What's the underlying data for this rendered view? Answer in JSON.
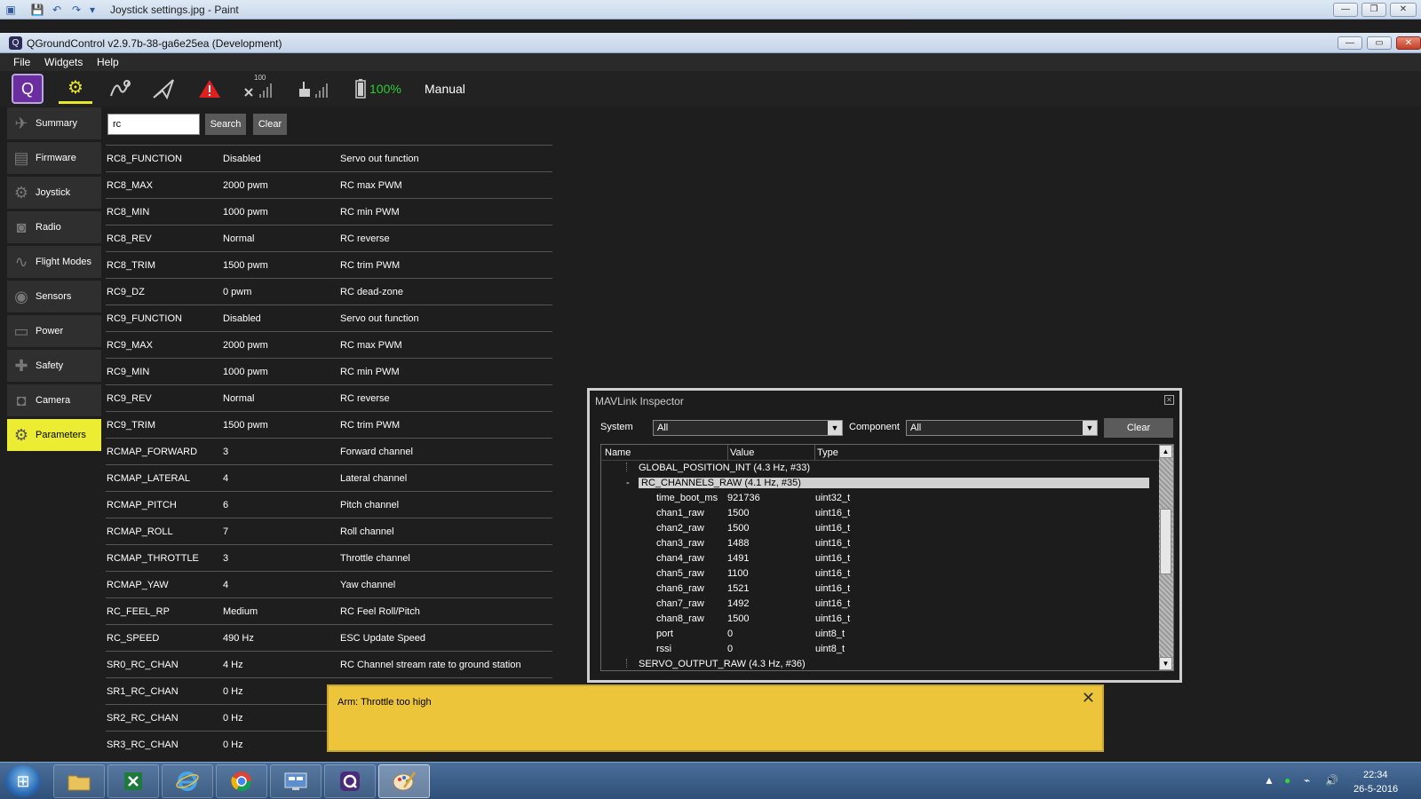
{
  "paint": {
    "title": "Joystick settings.jpg - Paint"
  },
  "window": {
    "title": "QGroundControl v2.9.7b-38-ga6e25ea (Development)"
  },
  "menubar": [
    "File",
    "Widgets",
    "Help"
  ],
  "toolbar": {
    "battery_percent": "100%",
    "flight_mode": "Manual",
    "gps_count_label": "100",
    "icons": [
      "qgc-logo-icon",
      "setup-gears-icon",
      "plan-waypoint-icon",
      "fly-paperplane-icon",
      "warning-icon",
      "gps-satellite-icon",
      "rc-signal-icon",
      "battery-icon"
    ],
    "colors": {
      "active_accent": "#e6e62a",
      "battery_ok": "#2ecc2e",
      "warning": "#e02020"
    }
  },
  "sidebar": {
    "items": [
      {
        "label": "Summary",
        "icon": "paperplane-icon"
      },
      {
        "label": "Firmware",
        "icon": "firmware-icon"
      },
      {
        "label": "Joystick",
        "icon": "joystick-icon"
      },
      {
        "label": "Radio",
        "icon": "radio-icon"
      },
      {
        "label": "Flight Modes",
        "icon": "waves-icon"
      },
      {
        "label": "Sensors",
        "icon": "sensors-icon"
      },
      {
        "label": "Power",
        "icon": "power-icon"
      },
      {
        "label": "Safety",
        "icon": "safety-icon"
      },
      {
        "label": "Camera",
        "icon": "camera-icon"
      },
      {
        "label": "Parameters",
        "icon": "gears-icon"
      }
    ],
    "active_index": 9
  },
  "search": {
    "value": "rc",
    "search_label": "Search",
    "clear_label": "Clear"
  },
  "params": [
    {
      "name": "RC8_FUNCTION",
      "value": "Disabled",
      "desc": "Servo out function"
    },
    {
      "name": "RC8_MAX",
      "value": "2000 pwm",
      "desc": "RC max PWM"
    },
    {
      "name": "RC8_MIN",
      "value": "1000 pwm",
      "desc": "RC min PWM"
    },
    {
      "name": "RC8_REV",
      "value": "Normal",
      "desc": "RC reverse"
    },
    {
      "name": "RC8_TRIM",
      "value": "1500 pwm",
      "desc": "RC trim PWM"
    },
    {
      "name": "RC9_DZ",
      "value": "0 pwm",
      "desc": "RC dead-zone"
    },
    {
      "name": "RC9_FUNCTION",
      "value": "Disabled",
      "desc": "Servo out function"
    },
    {
      "name": "RC9_MAX",
      "value": "2000 pwm",
      "desc": "RC max PWM"
    },
    {
      "name": "RC9_MIN",
      "value": "1000 pwm",
      "desc": "RC min PWM"
    },
    {
      "name": "RC9_REV",
      "value": "Normal",
      "desc": "RC reverse"
    },
    {
      "name": "RC9_TRIM",
      "value": "1500 pwm",
      "desc": "RC trim PWM"
    },
    {
      "name": "RCMAP_FORWARD",
      "value": "3",
      "desc": "Forward channel"
    },
    {
      "name": "RCMAP_LATERAL",
      "value": "4",
      "desc": "Lateral channel"
    },
    {
      "name": "RCMAP_PITCH",
      "value": "6",
      "desc": "Pitch channel"
    },
    {
      "name": "RCMAP_ROLL",
      "value": "7",
      "desc": "Roll channel"
    },
    {
      "name": "RCMAP_THROTTLE",
      "value": "3",
      "desc": "Throttle channel"
    },
    {
      "name": "RCMAP_YAW",
      "value": "4",
      "desc": "Yaw channel"
    },
    {
      "name": "RC_FEEL_RP",
      "value": "Medium",
      "desc": "RC Feel Roll/Pitch"
    },
    {
      "name": "RC_SPEED",
      "value": "490 Hz",
      "desc": "ESC Update Speed"
    },
    {
      "name": "SR0_RC_CHAN",
      "value": "4 Hz",
      "desc": "RC Channel stream rate to ground station"
    },
    {
      "name": "SR1_RC_CHAN",
      "value": "0 Hz",
      "desc": ""
    },
    {
      "name": "SR2_RC_CHAN",
      "value": "0 Hz",
      "desc": ""
    },
    {
      "name": "SR3_RC_CHAN",
      "value": "0 Hz",
      "desc": ""
    }
  ],
  "mavlink": {
    "title": "MAVLink Inspector",
    "system_label": "System",
    "system_value": "All",
    "component_label": "Component",
    "component_value": "All",
    "clear_label": "Clear",
    "columns": [
      "Name",
      "Value",
      "Type"
    ],
    "msg_above": "GLOBAL_POSITION_INT (4.3 Hz, #33)",
    "msg_selected": "RC_CHANNELS_RAW (4.1 Hz, #35)",
    "fields": [
      {
        "name": "time_boot_ms",
        "value": "921736",
        "type": "uint32_t"
      },
      {
        "name": "chan1_raw",
        "value": "1500",
        "type": "uint16_t"
      },
      {
        "name": "chan2_raw",
        "value": "1500",
        "type": "uint16_t"
      },
      {
        "name": "chan3_raw",
        "value": "1488",
        "type": "uint16_t"
      },
      {
        "name": "chan4_raw",
        "value": "1491",
        "type": "uint16_t"
      },
      {
        "name": "chan5_raw",
        "value": "1100",
        "type": "uint16_t"
      },
      {
        "name": "chan6_raw",
        "value": "1521",
        "type": "uint16_t"
      },
      {
        "name": "chan7_raw",
        "value": "1492",
        "type": "uint16_t"
      },
      {
        "name": "chan8_raw",
        "value": "1500",
        "type": "uint16_t"
      },
      {
        "name": "port",
        "value": "0",
        "type": "uint8_t"
      },
      {
        "name": "rssi",
        "value": "0",
        "type": "uint8_t"
      }
    ],
    "msg_below": "SERVO_OUTPUT_RAW (4.3 Hz, #36)"
  },
  "notification": {
    "text": "Arm: Throttle too high",
    "color": "#ecc53b"
  },
  "taskbar": {
    "apps": [
      "file-explorer-icon",
      "excel-icon",
      "internet-explorer-icon",
      "chrome-icon",
      "control-panel-icon",
      "qgroundcontrol-icon",
      "paint-icon"
    ],
    "active_app": "paint-icon",
    "time": "22:34",
    "date": "26-5-2016"
  }
}
